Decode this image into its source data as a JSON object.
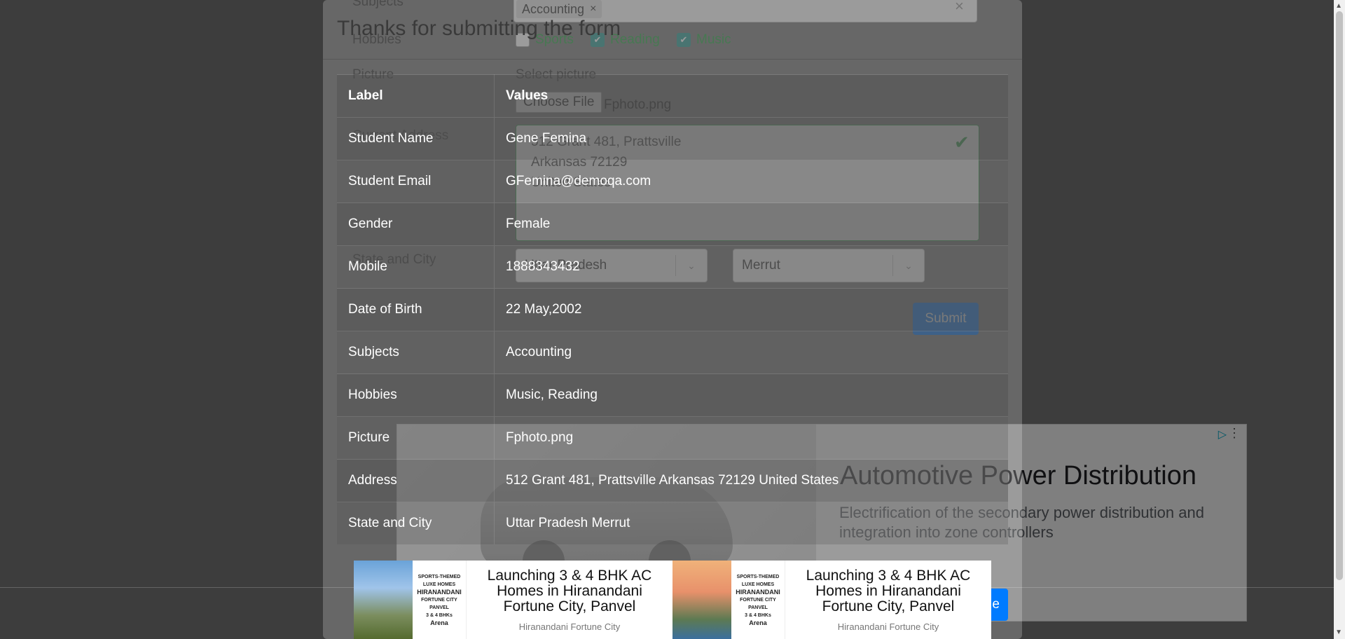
{
  "background_form": {
    "subjects_label": "Subjects",
    "subject_chip": "Accounting",
    "chip_remove": "×",
    "clear_all": "×",
    "hobbies_label": "Hobbies",
    "hobbies": [
      {
        "label": "Sports",
        "checked": false
      },
      {
        "label": "Reading",
        "checked": true
      },
      {
        "label": "Music",
        "checked": true
      }
    ],
    "picture_label": "Picture",
    "select_picture": "Select picture",
    "choose_file": "Choose File",
    "file_name": "Fphoto.png",
    "address_label": "Current Address",
    "address_lines": [
      "512 Grant 481, Prattsville",
      "Arkansas 72129",
      "United States"
    ],
    "state_city_label": "State and City",
    "state_value": "Uttar Pradesh",
    "city_value": "Merrut",
    "submit": "Submit"
  },
  "ad": {
    "title": "Automotive Power Distribution",
    "description": "Electrification of the secondary power distribution and integration into zone controllers"
  },
  "modal": {
    "title": "Thanks for submitting the form",
    "headers": {
      "label": "Label",
      "values": "Values"
    },
    "rows": [
      {
        "label": "Student Name",
        "value": "Gene Femina"
      },
      {
        "label": "Student Email",
        "value": "GFemina@demoqa.com"
      },
      {
        "label": "Gender",
        "value": "Female"
      },
      {
        "label": "Mobile",
        "value": "1888343432"
      },
      {
        "label": "Date of Birth",
        "value": "22 May,2002"
      },
      {
        "label": "Subjects",
        "value": "Accounting"
      },
      {
        "label": "Hobbies",
        "value": "Music, Reading"
      },
      {
        "label": "Picture",
        "value": "Fphoto.png"
      },
      {
        "label": "Address",
        "value": "512 Grant 481, Prattsville Arkansas 72129 United States"
      },
      {
        "label": "State and City",
        "value": "Uttar Pradesh Merrut"
      }
    ],
    "close_label": "e"
  },
  "banner": [
    {
      "headline": "Launching 3 & 4 BHK AC Homes in Hiranandani Fortune City, Panvel",
      "advertiser": "Hiranandani Fortune City"
    },
    {
      "headline": "Launching 3 & 4 BHK AC Homes in Hiranandani Fortune City, Panvel",
      "advertiser": "Hiranandani Fortune City"
    }
  ],
  "banner_logo": {
    "line1": "SPORTS-THEMED",
    "line2": "LUXE HOMES",
    "brand1": "HIRANANDANI",
    "brand2": "FORTUNE CITY",
    "brand3": "PANVEL",
    "tag": "3 & 4 BHKs",
    "project": "Arena"
  },
  "icons": {
    "check": "✔",
    "chevron": "⌄",
    "adchoices": "▷",
    "more": "⋮"
  }
}
